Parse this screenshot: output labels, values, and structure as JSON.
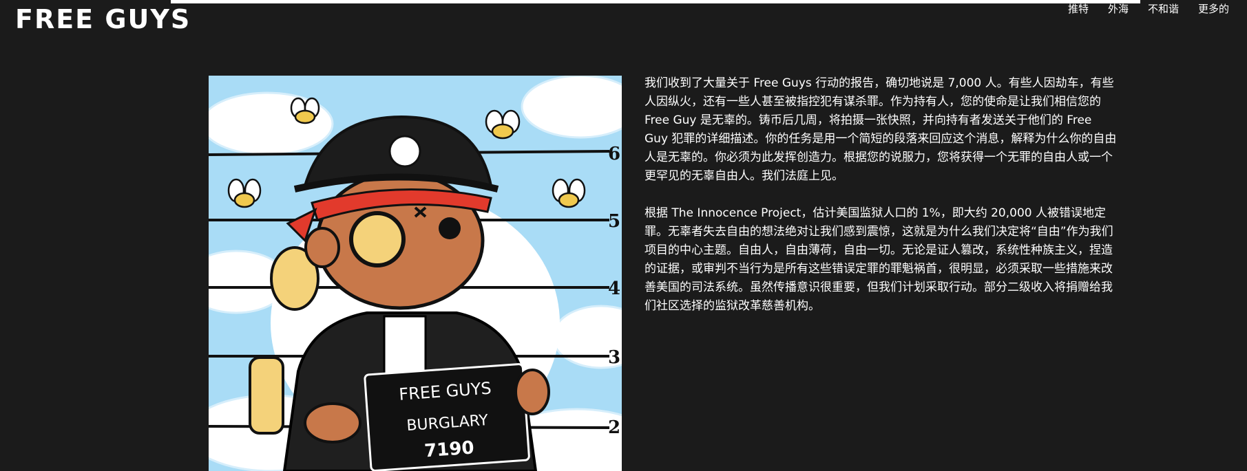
{
  "header": {
    "logo": "FREE GUYS",
    "nav": [
      "推特",
      "外海",
      "不和谐",
      "更多的"
    ]
  },
  "artwork": {
    "height_marks": [
      "6",
      "5",
      "4",
      "3",
      "2"
    ],
    "placard": {
      "line1": "FREE GUYS",
      "line2": "BURGLARY",
      "line3": "7190"
    },
    "colors": {
      "sky": "#a9dcf6",
      "skin": "#c8784a",
      "hat": "#1c1c1c",
      "bandana": "#e23a2c",
      "backpack": "#f4d27a"
    }
  },
  "main": {
    "paragraphs": [
      "我们收到了大量关于 Free Guys 行动的报告，确切地说是 7,000 人。有些人因劫车，有些人因纵火，还有一些人甚至被指控犯有谋杀罪。作为持有人，您的使命是让我们相信您的 Free Guy 是无辜的。铸币后几周，将拍摄一张快照，并向持有者发送关于他们的 Free Guy 犯罪的详细描述。你的任务是用一个简短的段落来回应这个消息，解释为什么你的自由人是无辜的。你必须为此发挥创造力。根据您的说服力，您将获得一个无罪的自由人或一个更罕见的无辜自由人。我们法庭上见。",
      "根据 The Innocence Project，估计美国监狱人口的 1%，即大约 20,000 人被错误地定罪。无辜者失去自由的想法绝对让我们感到震惊，这就是为什么我们决定将“自由”作为我们项目的中心主题。自由人，自由薄荷，自由一切。无论是证人篡改，系统性种族主义，捏造的证据，或审判不当行为是所有这些错误定罪的罪魁祸首，很明显，必须采取一些措施来改善美国的司法系统。虽然传播意识很重要，但我们计划采取行动。部分二级收入将捐赠给我们社区选择的监狱改革慈善机构。"
    ]
  }
}
